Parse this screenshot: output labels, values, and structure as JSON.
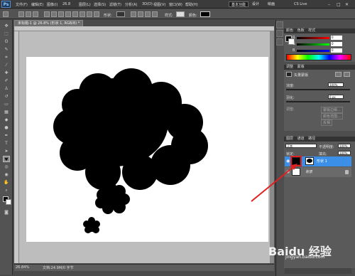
{
  "app": {
    "logo_text": "Ps",
    "menus": [
      "文件(F)",
      "编辑(E)",
      "图像(I)",
      "图层(L)",
      "选择(S)",
      "滤镜(T)",
      "分析(A)",
      "3D(D)",
      "视图(V)",
      "窗口(W)",
      "帮助(H)"
    ],
    "zoom_readout": "26.8",
    "workspace_buttons": [
      "基本功能",
      "设计",
      "绘画"
    ],
    "cs_live": "CS Live"
  },
  "options_bar": {
    "style_label": "样式:",
    "color_label": "颜色:",
    "shape_label": "形状:"
  },
  "document": {
    "tab_title": "未标题-1 @ 26.8% (形状 1, RGB/8) *",
    "zoom_status": "26.84%",
    "doc_status": "文档:24.9M/0 字节",
    "ruler_ticks": [
      "0",
      "5",
      "10",
      "15",
      "20",
      "25",
      "30",
      "35",
      "40",
      "45"
    ]
  },
  "color_panel": {
    "tabs": [
      "颜色",
      "色板",
      "样式"
    ],
    "r_value": "0",
    "g_value": "0",
    "b_value": "0",
    "r_letter": "R",
    "g_letter": "G",
    "b_letter": "B"
  },
  "masks_panel": {
    "tabs": [
      "调整",
      "蒙版"
    ],
    "title": "矢量蒙版",
    "density_label": "浓度:",
    "density_value": "100%",
    "feather_label": "羽化:",
    "feather_value": "0 px",
    "refine_label": "调整:",
    "edge_button": "蒙版边缘...",
    "color_range_button": "颜色范围...",
    "invert_button": "反相"
  },
  "layers_panel": {
    "tabs": [
      "图层",
      "通道",
      "路径"
    ],
    "blend_mode": "正常",
    "opacity_label": "不透明度:",
    "opacity_value": "100%",
    "lock_label": "锁定:",
    "fill_label": "填充:",
    "fill_value": "100%",
    "layers": [
      {
        "name": "形状 1",
        "selected": true
      },
      {
        "name": "背景",
        "selected": false
      }
    ]
  },
  "watermark": {
    "text": "Baidu 经验",
    "sub": "jingyan.baidu.com"
  },
  "colors": {
    "selection_blue": "#3b8fe6",
    "annotation_red": "#e02020",
    "shape_black": "#000000"
  }
}
